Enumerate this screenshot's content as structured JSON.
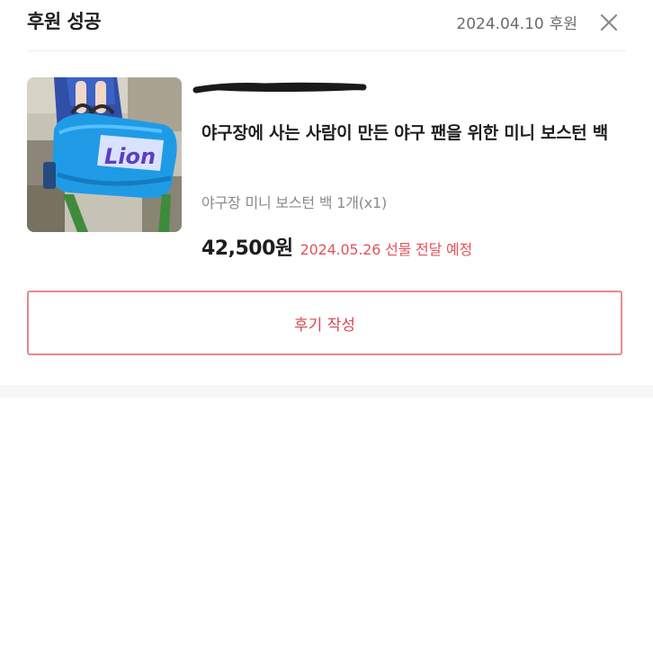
{
  "order": {
    "status": "후원 성공",
    "date": "2024.04.10",
    "date_label": "후원",
    "close_icon": "close-icon"
  },
  "product": {
    "creator": "",
    "title": "야구장에 사는 사람이 만든 야구 팬을 위한 미니 보스턴 백",
    "option": "야구장 미니 보스턴 백 1개(x1)",
    "price": "42,500원",
    "delivery": "2024.05.26 선물 전달 예정",
    "thumbnail": "product-thumbnail-image"
  },
  "actions": {
    "review_label": "후기 작성"
  },
  "colors": {
    "accent": "#e1545a",
    "border_accent": "#e58a8f",
    "muted_text": "#8a8a8a"
  }
}
